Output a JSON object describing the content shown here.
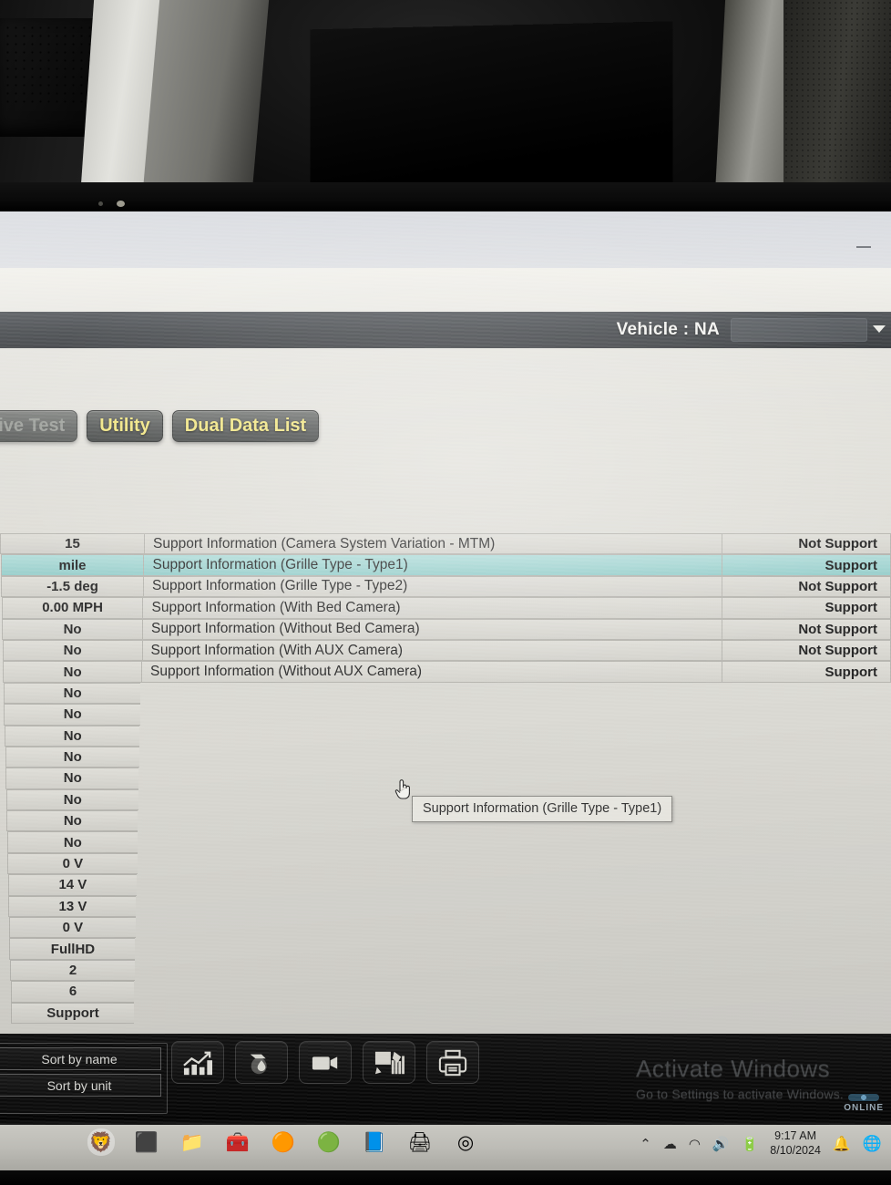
{
  "browser": {
    "minimize_label": "—",
    "bookmark_icon": "star-icon"
  },
  "app_header": {
    "vehicle_label": "Vehicle : NA",
    "vehicle_dropdown_value": "",
    "dropdown_icon": "chevron-down-icon"
  },
  "tabs": [
    {
      "label": "Active Test",
      "active": false,
      "dim": true
    },
    {
      "label": "Utility",
      "active": false,
      "dim": false
    },
    {
      "label": "Dual Data List",
      "active": true,
      "dim": false
    }
  ],
  "list": {
    "rows": [
      {
        "value": "15",
        "name": "Support Information (Camera System Variation - MTM)",
        "support": "Not Support",
        "selected": false
      },
      {
        "value": "mile",
        "name": "Support Information (Grille Type - Type1)",
        "support": "Support",
        "selected": true
      },
      {
        "value": "-1.5 deg",
        "name": "Support Information (Grille Type - Type2)",
        "support": "Not Support",
        "selected": false
      },
      {
        "value": "0.00 MPH",
        "name": "Support Information (With Bed Camera)",
        "support": "Support",
        "selected": false
      },
      {
        "value": "No",
        "name": "Support Information (Without Bed Camera)",
        "support": "Not Support",
        "selected": false
      },
      {
        "value": "No",
        "name": "Support Information (With AUX Camera)",
        "support": "Not Support",
        "selected": false
      },
      {
        "value": "No",
        "name": "Support Information (Without AUX Camera)",
        "support": "Support",
        "selected": false
      },
      {
        "value": "No",
        "name": "",
        "support": "",
        "selected": false
      },
      {
        "value": "No",
        "name": "",
        "support": "",
        "selected": false
      },
      {
        "value": "No",
        "name": "",
        "support": "",
        "selected": false
      },
      {
        "value": "No",
        "name": "",
        "support": "",
        "selected": false
      },
      {
        "value": "No",
        "name": "",
        "support": "",
        "selected": false
      },
      {
        "value": "No",
        "name": "",
        "support": "",
        "selected": false
      },
      {
        "value": "No",
        "name": "",
        "support": "",
        "selected": false
      },
      {
        "value": "No",
        "name": "",
        "support": "",
        "selected": false
      },
      {
        "value": "0 V",
        "name": "",
        "support": "",
        "selected": false
      },
      {
        "value": "14 V",
        "name": "",
        "support": "",
        "selected": false
      },
      {
        "value": "13 V",
        "name": "",
        "support": "",
        "selected": false
      },
      {
        "value": "0 V",
        "name": "",
        "support": "",
        "selected": false
      },
      {
        "value": "FullHD",
        "name": "",
        "support": "",
        "selected": false
      },
      {
        "value": "2",
        "name": "",
        "support": "",
        "selected": false
      },
      {
        "value": "6",
        "name": "",
        "support": "",
        "selected": false
      },
      {
        "value": "Support",
        "name": "",
        "support": "",
        "selected": false
      }
    ]
  },
  "tooltip": {
    "text": "Support Information (Grille Type - Type1)"
  },
  "cursor": {
    "icon": "pointing-hand-cursor"
  },
  "bottom_toolbar": {
    "sort_by_name": "Sort by name",
    "sort_by_unit": "Sort by unit",
    "icons": [
      {
        "name": "graph-chart-icon",
        "title": "Graph"
      },
      {
        "name": "oil-drop-icon",
        "title": "Fluid"
      },
      {
        "name": "video-camera-icon",
        "title": "Record"
      },
      {
        "name": "snapshot-chart-icon",
        "title": "Snapshot"
      },
      {
        "name": "printer-icon",
        "title": "Print"
      }
    ],
    "online_status": "ONLINE"
  },
  "watermark": {
    "line1": "Activate Windows",
    "line2": "Go to Settings to activate Windows."
  },
  "taskbar": {
    "apps": [
      {
        "name": "taskbar-lion-app",
        "glyph": "🦁",
        "active": true
      },
      {
        "name": "taskbar-file-explorer",
        "glyph": "⬛",
        "active": false
      },
      {
        "name": "taskbar-folder",
        "glyph": "📁",
        "active": false
      },
      {
        "name": "taskbar-toolbox",
        "glyph": "🧰",
        "active": false
      },
      {
        "name": "taskbar-firefox",
        "glyph": "🟠",
        "active": false
      },
      {
        "name": "taskbar-globe-app",
        "glyph": "🟢",
        "active": false
      },
      {
        "name": "taskbar-notes-app",
        "glyph": "📘",
        "active": false
      },
      {
        "name": "taskbar-scanner-app",
        "glyph": "🖨",
        "active": false
      },
      {
        "name": "taskbar-chrome",
        "glyph": "◎",
        "active": false
      }
    ],
    "tray": {
      "chevron": "⌃",
      "onedrive": "☁",
      "wifi": "◠",
      "volume": "🔊",
      "battery": "🔋",
      "time": "9:17 AM",
      "date": "8/10/2024",
      "bell": "🔔",
      "app": "🌐"
    }
  }
}
